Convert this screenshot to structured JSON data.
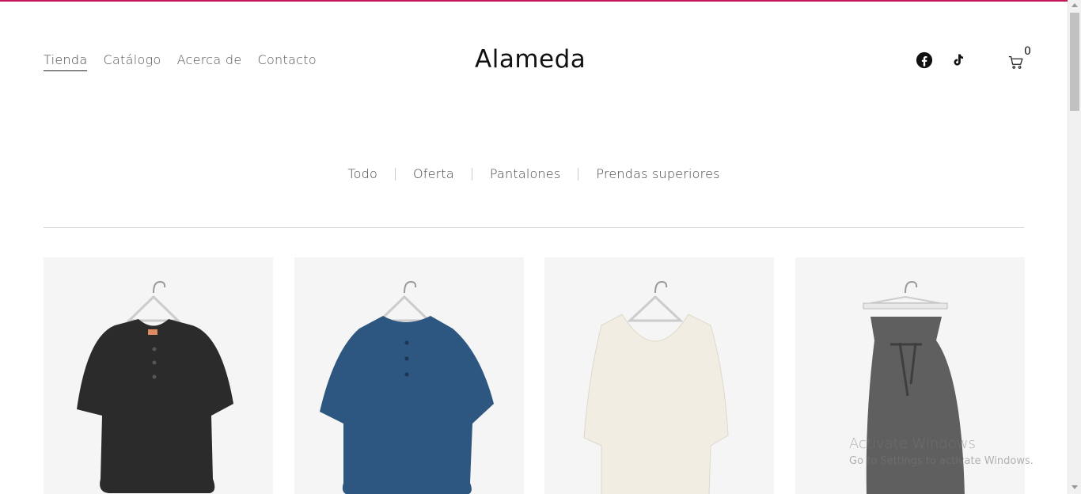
{
  "brand": {
    "name": "Alameda",
    "accent": "#c2185b"
  },
  "nav": {
    "items": [
      {
        "label": "Tienda",
        "active": true
      },
      {
        "label": "Catálogo",
        "active": false
      },
      {
        "label": "Acerca de",
        "active": false
      },
      {
        "label": "Contacto",
        "active": false
      }
    ]
  },
  "header": {
    "social": [
      {
        "icon": "facebook-icon"
      },
      {
        "icon": "tiktok-icon"
      }
    ],
    "cart": {
      "icon": "cart-icon",
      "count": "0"
    }
  },
  "filters": {
    "items": [
      {
        "label": "Todo"
      },
      {
        "label": "Oferta"
      },
      {
        "label": "Pantalones"
      },
      {
        "label": "Prendas superiores"
      }
    ]
  },
  "products": [
    {
      "image": "black-linen-shirt",
      "color": "#2b2b2b"
    },
    {
      "image": "blue-linen-shirt",
      "color": "#2d5680"
    },
    {
      "image": "cream-linen-top",
      "color": "#f1ede2"
    },
    {
      "image": "grey-linen-pants",
      "color": "#5f5f5f"
    }
  ],
  "watermark": {
    "title": "Activate Windows",
    "subtitle": "Go to Settings to activate Windows."
  }
}
